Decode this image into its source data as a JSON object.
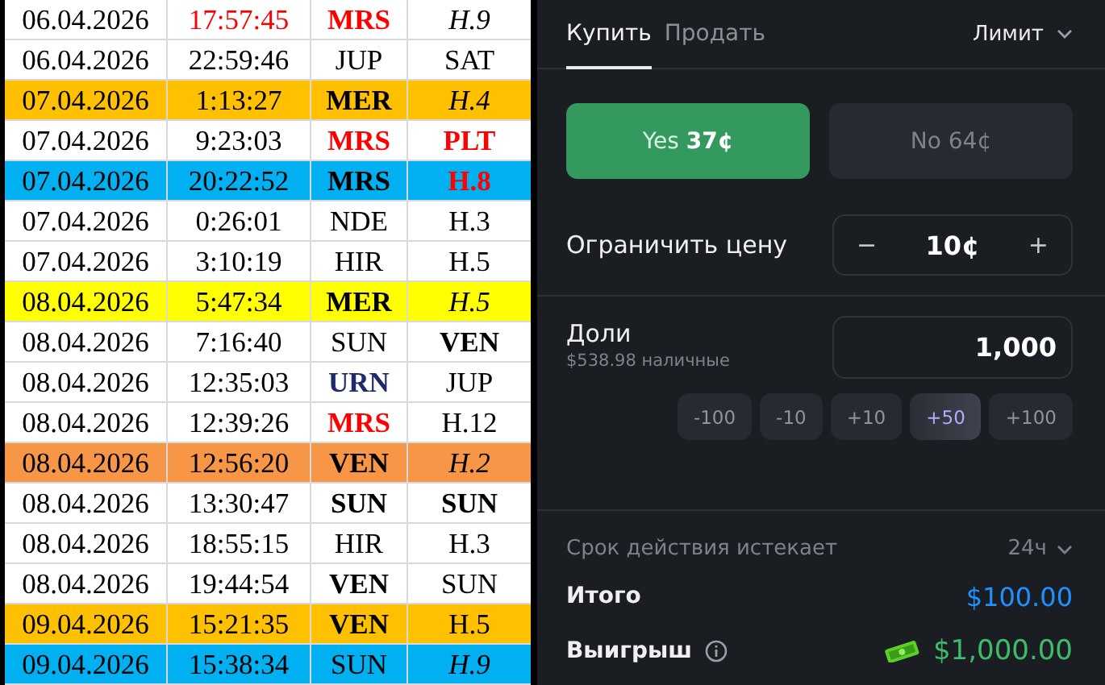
{
  "table": {
    "rows": [
      {
        "color": "#ffffff",
        "cells": [
          {
            "text": "06.04.2026",
            "color": "#000000",
            "bold": false,
            "italic": false
          },
          {
            "text": "17:57:45",
            "color": "#ff0000",
            "bold": false,
            "italic": false
          },
          {
            "text": "MRS",
            "color": "#ff0000",
            "bold": true,
            "italic": false
          },
          {
            "text": "H.9",
            "color": "#000000",
            "bold": false,
            "italic": true
          }
        ]
      },
      {
        "color": "#ffffff",
        "cells": [
          {
            "text": "06.04.2026",
            "color": "#000000",
            "bold": false,
            "italic": false
          },
          {
            "text": "22:59:46",
            "color": "#000000",
            "bold": false,
            "italic": false
          },
          {
            "text": "JUP",
            "color": "#000000",
            "bold": false,
            "italic": false
          },
          {
            "text": "SAT",
            "color": "#000000",
            "bold": false,
            "italic": false
          }
        ]
      },
      {
        "color": "#ffc000",
        "cells": [
          {
            "text": "07.04.2026",
            "color": "#000000",
            "bold": false,
            "italic": false
          },
          {
            "text": "1:13:27",
            "color": "#000000",
            "bold": false,
            "italic": false
          },
          {
            "text": "MER",
            "color": "#000000",
            "bold": true,
            "italic": false
          },
          {
            "text": "H.4",
            "color": "#000000",
            "bold": false,
            "italic": true
          }
        ]
      },
      {
        "color": "#ffffff",
        "cells": [
          {
            "text": "07.04.2026",
            "color": "#000000",
            "bold": false,
            "italic": false
          },
          {
            "text": "9:23:03",
            "color": "#000000",
            "bold": false,
            "italic": false
          },
          {
            "text": "MRS",
            "color": "#ff0000",
            "bold": true,
            "italic": false
          },
          {
            "text": "PLT",
            "color": "#ff0000",
            "bold": true,
            "italic": false
          }
        ]
      },
      {
        "color": "#00b0f0",
        "cells": [
          {
            "text": "07.04.2026",
            "color": "#000000",
            "bold": false,
            "italic": false
          },
          {
            "text": "20:22:52",
            "color": "#000000",
            "bold": false,
            "italic": false
          },
          {
            "text": "MRS",
            "color": "#000000",
            "bold": true,
            "italic": false
          },
          {
            "text": "H.8",
            "color": "#ff0000",
            "bold": true,
            "italic": false
          }
        ]
      },
      {
        "color": "#ffffff",
        "cells": [
          {
            "text": "07.04.2026",
            "color": "#000000",
            "bold": false,
            "italic": false
          },
          {
            "text": "0:26:01",
            "color": "#000000",
            "bold": false,
            "italic": false
          },
          {
            "text": "NDE",
            "color": "#000000",
            "bold": false,
            "italic": false
          },
          {
            "text": "H.3",
            "color": "#000000",
            "bold": false,
            "italic": false
          }
        ]
      },
      {
        "color": "#ffffff",
        "cells": [
          {
            "text": "07.04.2026",
            "color": "#000000",
            "bold": false,
            "italic": false
          },
          {
            "text": "3:10:19",
            "color": "#000000",
            "bold": false,
            "italic": false
          },
          {
            "text": "HIR",
            "color": "#000000",
            "bold": false,
            "italic": false
          },
          {
            "text": "H.5",
            "color": "#000000",
            "bold": false,
            "italic": false
          }
        ]
      },
      {
        "color": "#ffff00",
        "cells": [
          {
            "text": "08.04.2026",
            "color": "#000000",
            "bold": false,
            "italic": false
          },
          {
            "text": "5:47:34",
            "color": "#000000",
            "bold": false,
            "italic": false
          },
          {
            "text": "MER",
            "color": "#000000",
            "bold": true,
            "italic": false
          },
          {
            "text": "H.5",
            "color": "#000000",
            "bold": false,
            "italic": true
          }
        ]
      },
      {
        "color": "#ffffff",
        "cells": [
          {
            "text": "08.04.2026",
            "color": "#000000",
            "bold": false,
            "italic": false
          },
          {
            "text": "7:16:40",
            "color": "#000000",
            "bold": false,
            "italic": false
          },
          {
            "text": "SUN",
            "color": "#000000",
            "bold": false,
            "italic": false
          },
          {
            "text": "VEN",
            "color": "#000000",
            "bold": true,
            "italic": false
          }
        ]
      },
      {
        "color": "#ffffff",
        "cells": [
          {
            "text": "08.04.2026",
            "color": "#000000",
            "bold": false,
            "italic": false
          },
          {
            "text": "12:35:03",
            "color": "#000000",
            "bold": false,
            "italic": false
          },
          {
            "text": "URN",
            "color": "#1f2a6b",
            "bold": true,
            "italic": false
          },
          {
            "text": "JUP",
            "color": "#000000",
            "bold": false,
            "italic": false
          }
        ]
      },
      {
        "color": "#ffffff",
        "cells": [
          {
            "text": "08.04.2026",
            "color": "#000000",
            "bold": false,
            "italic": false
          },
          {
            "text": "12:39:26",
            "color": "#000000",
            "bold": false,
            "italic": false
          },
          {
            "text": "MRS",
            "color": "#ff0000",
            "bold": true,
            "italic": false
          },
          {
            "text": "H.12",
            "color": "#000000",
            "bold": false,
            "italic": false
          }
        ]
      },
      {
        "color": "#f79646",
        "cells": [
          {
            "text": "08.04.2026",
            "color": "#000000",
            "bold": false,
            "italic": false
          },
          {
            "text": "12:56:20",
            "color": "#000000",
            "bold": false,
            "italic": false
          },
          {
            "text": "VEN",
            "color": "#000000",
            "bold": true,
            "italic": false
          },
          {
            "text": "H.2",
            "color": "#000000",
            "bold": false,
            "italic": true
          }
        ]
      },
      {
        "color": "#ffffff",
        "cells": [
          {
            "text": "08.04.2026",
            "color": "#000000",
            "bold": false,
            "italic": false
          },
          {
            "text": "13:30:47",
            "color": "#000000",
            "bold": false,
            "italic": false
          },
          {
            "text": "SUN",
            "color": "#000000",
            "bold": true,
            "italic": false
          },
          {
            "text": "SUN",
            "color": "#000000",
            "bold": true,
            "italic": false
          }
        ]
      },
      {
        "color": "#ffffff",
        "cells": [
          {
            "text": "08.04.2026",
            "color": "#000000",
            "bold": false,
            "italic": false
          },
          {
            "text": "18:55:15",
            "color": "#000000",
            "bold": false,
            "italic": false
          },
          {
            "text": "HIR",
            "color": "#000000",
            "bold": false,
            "italic": false
          },
          {
            "text": "H.3",
            "color": "#000000",
            "bold": false,
            "italic": false
          }
        ]
      },
      {
        "color": "#ffffff",
        "cells": [
          {
            "text": "08.04.2026",
            "color": "#000000",
            "bold": false,
            "italic": false
          },
          {
            "text": "19:44:54",
            "color": "#000000",
            "bold": false,
            "italic": false
          },
          {
            "text": "VEN",
            "color": "#000000",
            "bold": true,
            "italic": false
          },
          {
            "text": "SUN",
            "color": "#000000",
            "bold": false,
            "italic": false
          }
        ]
      },
      {
        "color": "#ffc000",
        "cells": [
          {
            "text": "09.04.2026",
            "color": "#000000",
            "bold": false,
            "italic": false
          },
          {
            "text": "15:21:35",
            "color": "#000000",
            "bold": false,
            "italic": false
          },
          {
            "text": "VEN",
            "color": "#000000",
            "bold": true,
            "italic": false
          },
          {
            "text": "H.5",
            "color": "#000000",
            "bold": false,
            "italic": false
          }
        ]
      },
      {
        "color": "#00b0f0",
        "cells": [
          {
            "text": "09.04.2026",
            "color": "#000000",
            "bold": false,
            "italic": false
          },
          {
            "text": "15:38:34",
            "color": "#000000",
            "bold": false,
            "italic": false
          },
          {
            "text": "SUN",
            "color": "#000000",
            "bold": false,
            "italic": false
          },
          {
            "text": "H.9",
            "color": "#000000",
            "bold": false,
            "italic": true
          }
        ]
      }
    ]
  },
  "order_panel": {
    "tabs": [
      {
        "label": "Купить",
        "selected": true
      },
      {
        "label": "Продать",
        "selected": false
      }
    ],
    "order_type": "Лимит",
    "outcomes": [
      {
        "label": "Yes **37¢**",
        "kind": "yes",
        "selected": true
      },
      {
        "label": "No 64¢",
        "kind": "no",
        "selected": false
      }
    ],
    "limit_price": {
      "label": "Ограничить цену",
      "minus": "−",
      "value": "10¢",
      "plus": "+"
    },
    "shares": {
      "label": "Доли",
      "cash": "$538.98 наличные",
      "value": "1,000"
    },
    "adjust_buttons": [
      {
        "label": "-100",
        "selected": false
      },
      {
        "label": "-10",
        "selected": false
      },
      {
        "label": "+10",
        "selected": false
      },
      {
        "label": "+50",
        "selected": true
      },
      {
        "label": "+100",
        "selected": false
      }
    ],
    "expiry": {
      "label": "Срок действия истекает",
      "value": "24ч"
    },
    "total": {
      "label": "Итого",
      "value": "$100.00"
    },
    "payout": {
      "label": "Выигрыш",
      "value": "$1,000.00"
    }
  }
}
